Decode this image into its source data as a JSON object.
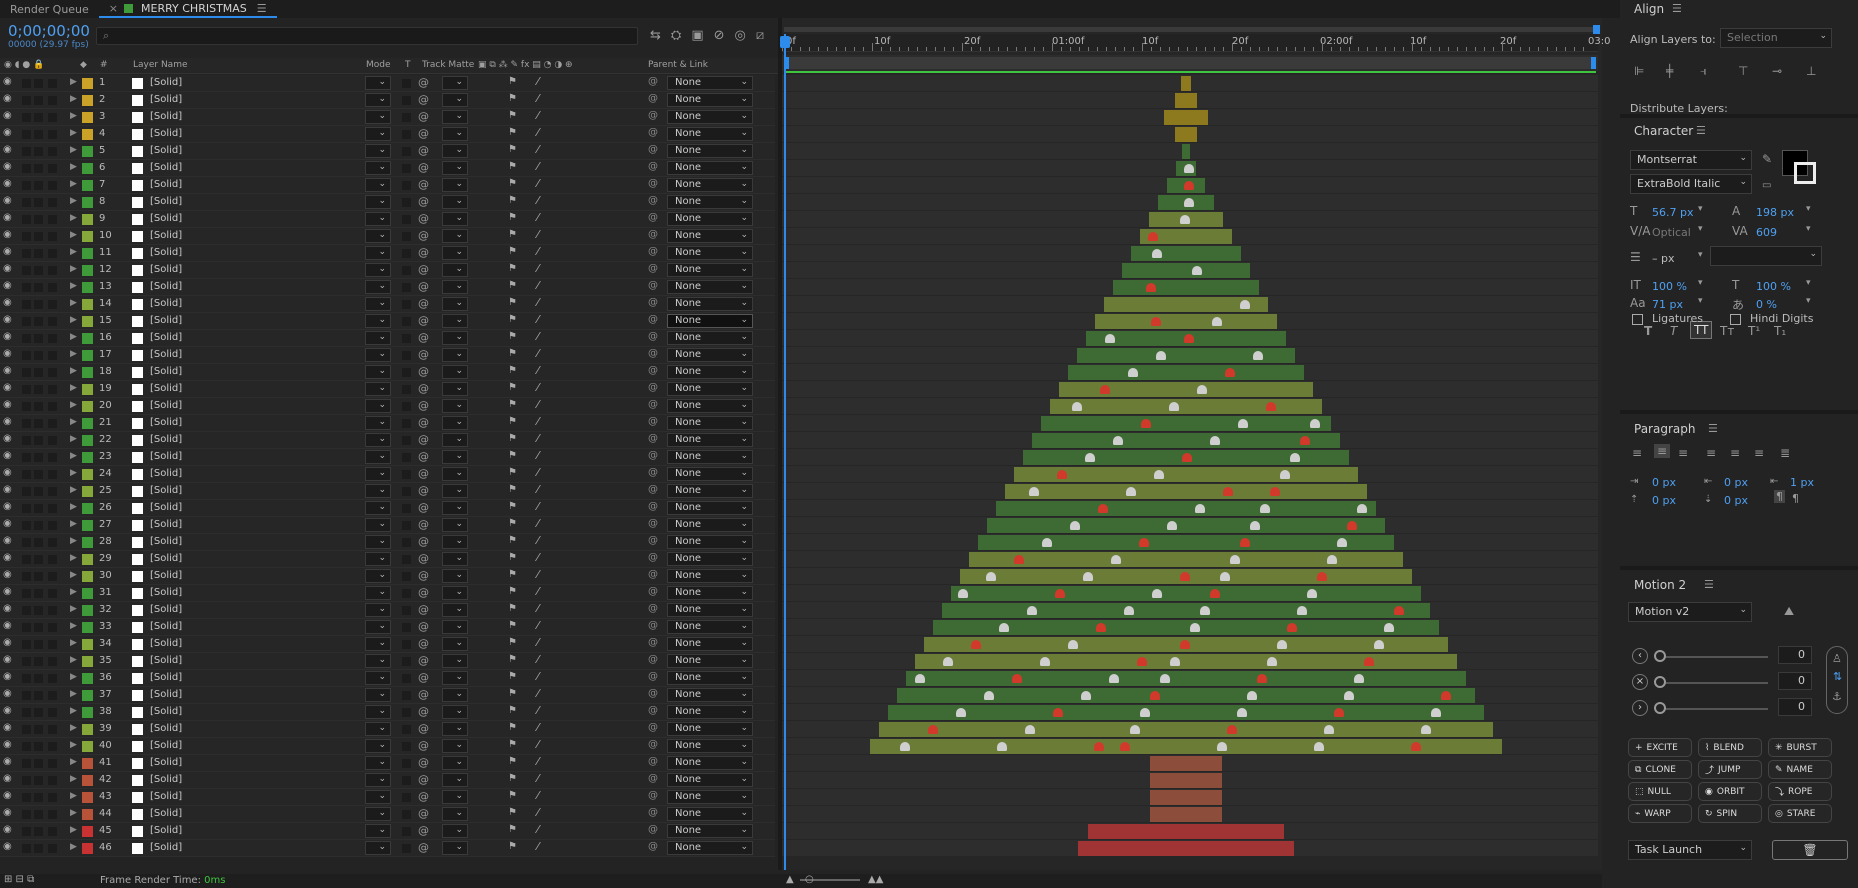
{
  "tabs": {
    "render_queue": "Render Queue",
    "comp_name": "MERRY CHRISTMAS"
  },
  "timecode": "0;00;00;00",
  "fps": "00000 (29.97 fps)",
  "search": {
    "placeholder": ""
  },
  "columns": {
    "layer_name": "Layer Name",
    "mode": "Mode",
    "t": "T",
    "track_matte": "Track Matte",
    "parent_link": "Parent & Link"
  },
  "layers": [
    {
      "num": "1",
      "name": "[Solid]",
      "label": "#c9a227",
      "mode": "",
      "matte": "",
      "parent": "None"
    },
    {
      "num": "2",
      "name": "[Solid]",
      "label": "#c9a227",
      "mode": "",
      "matte": "",
      "parent": "None"
    },
    {
      "num": "3",
      "name": "[Solid]",
      "label": "#c9a227",
      "mode": "",
      "matte": "",
      "parent": "None"
    },
    {
      "num": "4",
      "name": "[Solid]",
      "label": "#c9a227",
      "mode": "",
      "matte": "",
      "parent": "None"
    },
    {
      "num": "5",
      "name": "[Solid]",
      "label": "#3f9a3a",
      "mode": "",
      "matte": "",
      "parent": "None"
    },
    {
      "num": "6",
      "name": "[Solid]",
      "label": "#3f9a3a",
      "mode": "",
      "matte": "",
      "parent": "None"
    },
    {
      "num": "7",
      "name": "[Solid]",
      "label": "#3f9a3a",
      "mode": "",
      "matte": "",
      "parent": "None"
    },
    {
      "num": "8",
      "name": "[Solid]",
      "label": "#3f9a3a",
      "mode": "",
      "matte": "",
      "parent": "None"
    },
    {
      "num": "9",
      "name": "[Solid]",
      "label": "#86a83a",
      "mode": "",
      "matte": "",
      "parent": "None"
    },
    {
      "num": "10",
      "name": "[Solid]",
      "label": "#86a83a",
      "mode": "",
      "matte": "",
      "parent": "None"
    },
    {
      "num": "11",
      "name": "[Solid]",
      "label": "#3f9a3a",
      "mode": "",
      "matte": "",
      "parent": "None"
    },
    {
      "num": "12",
      "name": "[Solid]",
      "label": "#3f9a3a",
      "mode": "",
      "matte": "",
      "parent": "None"
    },
    {
      "num": "13",
      "name": "[Solid]",
      "label": "#3f9a3a",
      "mode": "",
      "matte": "",
      "parent": "None"
    },
    {
      "num": "14",
      "name": "[Solid]",
      "label": "#86a83a",
      "mode": "",
      "matte": "",
      "parent": "None"
    },
    {
      "num": "15",
      "name": "[Solid]",
      "label": "#86a83a",
      "mode": "",
      "matte": "",
      "parent": "None"
    },
    {
      "num": "16",
      "name": "[Solid]",
      "label": "#3f9a3a",
      "mode": "",
      "matte": "",
      "parent": "None"
    },
    {
      "num": "17",
      "name": "[Solid]",
      "label": "#3f9a3a",
      "mode": "",
      "matte": "",
      "parent": "None"
    },
    {
      "num": "18",
      "name": "[Solid]",
      "label": "#3f9a3a",
      "mode": "",
      "matte": "",
      "parent": "None"
    },
    {
      "num": "19",
      "name": "[Solid]",
      "label": "#86a83a",
      "mode": "",
      "matte": "",
      "parent": "None"
    },
    {
      "num": "20",
      "name": "[Solid]",
      "label": "#86a83a",
      "mode": "",
      "matte": "",
      "parent": "None"
    },
    {
      "num": "21",
      "name": "[Solid]",
      "label": "#3f9a3a",
      "mode": "",
      "matte": "",
      "parent": "None"
    },
    {
      "num": "22",
      "name": "[Solid]",
      "label": "#3f9a3a",
      "mode": "",
      "matte": "",
      "parent": "None"
    },
    {
      "num": "23",
      "name": "[Solid]",
      "label": "#3f9a3a",
      "mode": "",
      "matte": "",
      "parent": "None"
    },
    {
      "num": "24",
      "name": "[Solid]",
      "label": "#86a83a",
      "mode": "",
      "matte": "",
      "parent": "None"
    },
    {
      "num": "25",
      "name": "[Solid]",
      "label": "#86a83a",
      "mode": "",
      "matte": "",
      "parent": "None"
    },
    {
      "num": "26",
      "name": "[Solid]",
      "label": "#3f9a3a",
      "mode": "",
      "matte": "",
      "parent": "None"
    },
    {
      "num": "27",
      "name": "[Solid]",
      "label": "#3f9a3a",
      "mode": "",
      "matte": "",
      "parent": "None"
    },
    {
      "num": "28",
      "name": "[Solid]",
      "label": "#3f9a3a",
      "mode": "",
      "matte": "",
      "parent": "None"
    },
    {
      "num": "29",
      "name": "[Solid]",
      "label": "#86a83a",
      "mode": "",
      "matte": "",
      "parent": "None"
    },
    {
      "num": "30",
      "name": "[Solid]",
      "label": "#86a83a",
      "mode": "",
      "matte": "",
      "parent": "None"
    },
    {
      "num": "31",
      "name": "[Solid]",
      "label": "#3f9a3a",
      "mode": "",
      "matte": "",
      "parent": "None"
    },
    {
      "num": "32",
      "name": "[Solid]",
      "label": "#3f9a3a",
      "mode": "",
      "matte": "",
      "parent": "None"
    },
    {
      "num": "33",
      "name": "[Solid]",
      "label": "#3f9a3a",
      "mode": "",
      "matte": "",
      "parent": "None"
    },
    {
      "num": "34",
      "name": "[Solid]",
      "label": "#86a83a",
      "mode": "",
      "matte": "",
      "parent": "None"
    },
    {
      "num": "35",
      "name": "[Solid]",
      "label": "#86a83a",
      "mode": "",
      "matte": "",
      "parent": "None"
    },
    {
      "num": "36",
      "name": "[Solid]",
      "label": "#3f9a3a",
      "mode": "",
      "matte": "",
      "parent": "None"
    },
    {
      "num": "37",
      "name": "[Solid]",
      "label": "#3f9a3a",
      "mode": "",
      "matte": "",
      "parent": "None"
    },
    {
      "num": "38",
      "name": "[Solid]",
      "label": "#3f9a3a",
      "mode": "",
      "matte": "",
      "parent": "None"
    },
    {
      "num": "39",
      "name": "[Solid]",
      "label": "#86a83a",
      "mode": "",
      "matte": "",
      "parent": "None"
    },
    {
      "num": "40",
      "name": "[Solid]",
      "label": "#86a83a",
      "mode": "",
      "matte": "",
      "parent": "None"
    },
    {
      "num": "41",
      "name": "[Solid]",
      "label": "#b8533a",
      "mode": "",
      "matte": "",
      "parent": "None"
    },
    {
      "num": "42",
      "name": "[Solid]",
      "label": "#b8533a",
      "mode": "",
      "matte": "",
      "parent": "None"
    },
    {
      "num": "43",
      "name": "[Solid]",
      "label": "#b8533a",
      "mode": "",
      "matte": "",
      "parent": "None"
    },
    {
      "num": "44",
      "name": "[Solid]",
      "label": "#b8533a",
      "mode": "",
      "matte": "",
      "parent": "None"
    },
    {
      "num": "45",
      "name": "[Solid]",
      "label": "#c83232",
      "mode": "",
      "matte": "",
      "parent": "None"
    },
    {
      "num": "46",
      "name": "[Solid]",
      "label": "#c83232",
      "mode": "",
      "matte": "",
      "parent": "None"
    }
  ],
  "ruler_labels": [
    "0f",
    "10f",
    "20f",
    "01:00f",
    "10f",
    "20f",
    "02:00f",
    "10f",
    "20f",
    "03:0"
  ],
  "status": {
    "label": "Frame Render Time:",
    "value": "0ms"
  },
  "align": {
    "title": "Align",
    "align_to_label": "Align Layers to:",
    "align_to_value": "Selection",
    "distribute": "Distribute Layers:"
  },
  "character": {
    "title": "Character",
    "font": "Montserrat",
    "style": "ExtraBold Italic",
    "size": "56.7 px",
    "leading": "198 px",
    "kerning": "Optical",
    "tracking": "609",
    "stroke": "– px",
    "vscale": "100 %",
    "hscale": "100 %",
    "baseline": "71 px",
    "tsume": "0 %",
    "ligatures": "Ligatures",
    "hindi": "Hindi Digits",
    "fill_color": "#000000"
  },
  "paragraph": {
    "title": "Paragraph",
    "indent_left": "0 px",
    "indent_first": "0 px",
    "indent_right": "1 px",
    "space_before": "0 px",
    "space_after": "0 px"
  },
  "motion": {
    "title": "Motion 2",
    "version": "Motion v2",
    "values": [
      "0",
      "0",
      "0"
    ],
    "buttons": [
      "EXCITE",
      "BLEND",
      "BURST",
      "CLONE",
      "JUMP",
      "NAME",
      "NULL",
      "ORBIT",
      "ROPE",
      "WARP",
      "SPIN",
      "STARE"
    ],
    "task": "Task Launch"
  },
  "tree_colors": {
    "gold": "#8d7a1f",
    "dark_green": "#3e6b33",
    "light_green": "#6b7c37",
    "trunk": "#8c4d3b",
    "base": "#a03333",
    "ornament_red": "#d13a2a",
    "ornament_white": "#cfcfcf"
  }
}
